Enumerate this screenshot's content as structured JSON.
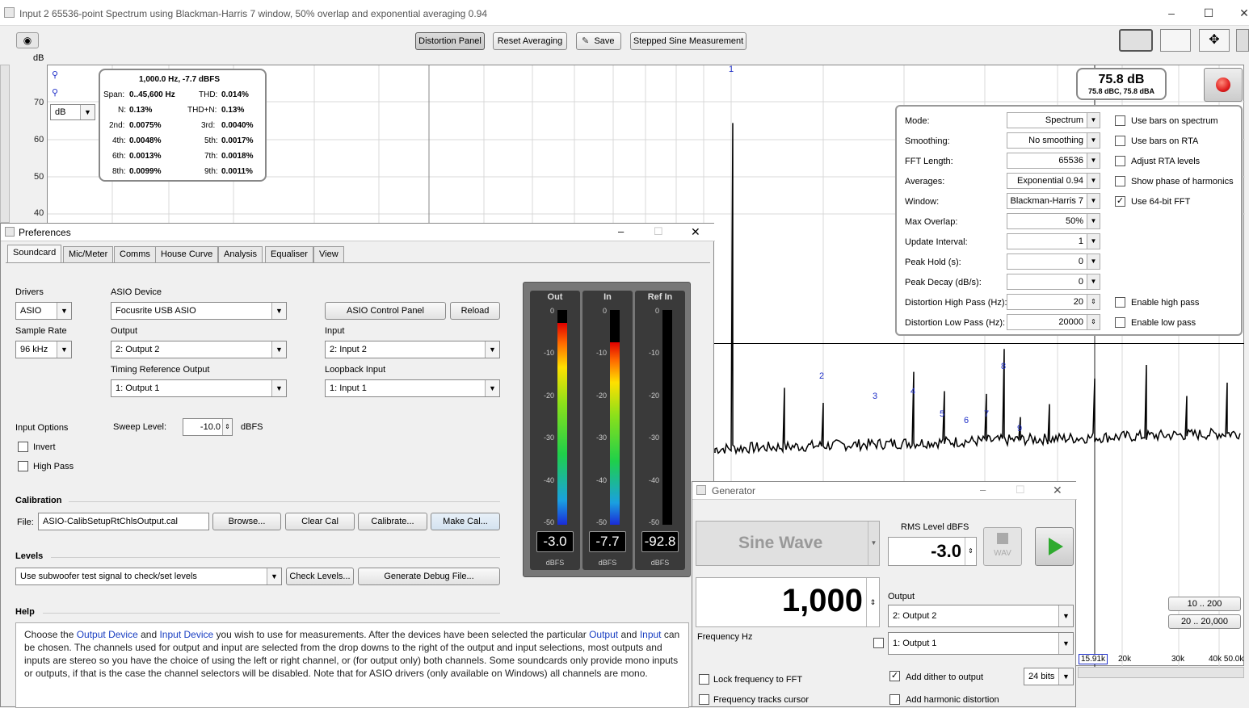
{
  "window": {
    "title": "Input 2 65536-point Spectrum using Blackman-Harris 7 window, 50% overlap and exponential averaging 0.94"
  },
  "toolbar": {
    "distortion_panel": "Distortion Panel",
    "reset_averaging": "Reset Averaging",
    "save": "Save",
    "stepped_sine": "Stepped Sine Measurement"
  },
  "plot": {
    "y_unit": "dB",
    "y_ticks": [
      "70",
      "60",
      "50",
      "40"
    ],
    "units_select": "dB",
    "harmonic_labels": [
      "1",
      "2",
      "3",
      "4",
      "5",
      "6",
      "7",
      "8",
      "9"
    ],
    "x_ticks": [
      "15.91k",
      "20k",
      "30k",
      "40k 50.0k"
    ],
    "range_buttons": [
      "10 .. 200",
      "20 .. 20,000"
    ]
  },
  "stats": {
    "header": "1,000.0 Hz, -7.7 dBFS",
    "span_label": "Span:",
    "span": "0..45,600 Hz",
    "thd_label": "THD:",
    "thd": "0.014%",
    "n_label": "N:",
    "n": "0.13%",
    "thdn_label": "THD+N:",
    "thdn": "0.13%",
    "h2_label": "2nd:",
    "h2": "0.0075%",
    "h3_label": "3rd:",
    "h3": "0.0040%",
    "h4_label": "4th:",
    "h4": "0.0048%",
    "h5_label": "5th:",
    "h5": "0.0017%",
    "h6_label": "6th:",
    "h6": "0.0013%",
    "h7_label": "7th:",
    "h7": "0.0018%",
    "h8_label": "8th:",
    "h8": "0.0099%",
    "h9_label": "9th:",
    "h9": "0.0011%"
  },
  "level_readout": {
    "main": "75.8 dB",
    "sub": "75.8 dBC, 75.8 dBA"
  },
  "config": {
    "mode_label": "Mode:",
    "mode": "Spectrum",
    "smoothing_label": "Smoothing:",
    "smoothing": "No  smoothing",
    "fft_label": "FFT Length:",
    "fft": "65536",
    "averages_label": "Averages:",
    "averages": "Exponential 0.94",
    "window_label": "Window:",
    "window": "Blackman-Harris 7",
    "overlap_label": "Max Overlap:",
    "overlap": "50%",
    "update_label": "Update Interval:",
    "update": "1",
    "peakhold_label": "Peak Hold (s):",
    "peakhold": "0",
    "peakdecay_label": "Peak Decay (dB/s):",
    "peakdecay": "0",
    "dhp_label": "Distortion High Pass (Hz):",
    "dhp": "20",
    "dlp_label": "Distortion Low Pass (Hz):",
    "dlp": "20000",
    "bars_spectrum": "Use bars on spectrum",
    "bars_rta": "Use bars on RTA",
    "adjust_rta": "Adjust RTA levels",
    "phase_harm": "Show phase of harmonics",
    "fft64": "Use 64-bit FFT",
    "enable_hp": "Enable high pass",
    "enable_lp": "Enable low pass",
    "checks": {
      "bars_spectrum": false,
      "bars_rta": false,
      "adjust_rta": false,
      "phase_harm": false,
      "fft64": true,
      "enable_hp": false,
      "enable_lp": false
    }
  },
  "prefs": {
    "title": "Preferences",
    "tabs": [
      "Soundcard",
      "Mic/Meter",
      "Comms",
      "House Curve",
      "Analysis",
      "Equaliser",
      "View"
    ],
    "drivers_label": "Drivers",
    "drivers": "ASIO",
    "asio_device_label": "ASIO Device",
    "asio_device": "Focusrite USB ASIO",
    "asio_control": "ASIO Control Panel",
    "reload": "Reload",
    "sample_rate_label": "Sample Rate",
    "sample_rate": "96 kHz",
    "output_label": "Output",
    "output": "2: Output 2",
    "input_label": "Input",
    "input": "2: Input 2",
    "timing_label": "Timing Reference Output",
    "timing": "1: Output 1",
    "loopback_label": "Loopback Input",
    "loopback": "1: Input 1",
    "input_options_label": "Input Options",
    "sweep_label": "Sweep Level:",
    "sweep": "-10.0",
    "sweep_unit": "dBFS",
    "invert": "Invert",
    "highpass": "High Pass",
    "calibration_label": "Calibration",
    "file_label": "File:",
    "cal_file": "ASIO-CalibSetupRtChlsOutput.cal",
    "browse": "Browse...",
    "clear_cal": "Clear Cal",
    "calibrate": "Calibrate...",
    "make_cal": "Make Cal...",
    "levels_label": "Levels",
    "levels_select": "Use subwoofer test signal to check/set levels",
    "check_levels": "Check Levels...",
    "debug": "Generate Debug File...",
    "help_label": "Help",
    "help_parts": [
      "Choose the ",
      "Output Device",
      " and ",
      "Input Device",
      " you wish to use for measurements. After the devices have been selected the particular ",
      "Output",
      " and ",
      "Input",
      " can be chosen. The channels used for output and input are selected from the drop downs to the right of the output and input selections, most outputs and inputs are stereo so you have the choice of using the left or right channel, or (for output only) both channels. Some soundcards only provide mono inputs or outputs, if that is the case the channel selectors will be disabled. Note that for ASIO drivers (only available on Windows) all channels are mono."
    ]
  },
  "meters": [
    {
      "name": "Out",
      "value": "-3.0",
      "unit": "dBFS",
      "level": 0.94
    },
    {
      "name": "In",
      "value": "-7.7",
      "unit": "dBFS",
      "level": 0.85
    },
    {
      "name": "Ref In",
      "value": "-92.8",
      "unit": "dBFS",
      "level": 0
    }
  ],
  "meter_ticks": [
    "0",
    "-10",
    "-20",
    "-30",
    "-40",
    "-50"
  ],
  "generator": {
    "title": "Generator",
    "waveform": "Sine Wave",
    "rms_label": "RMS Level dBFS",
    "rms": "-3.0",
    "wav": "WAV",
    "frequency": "1,000",
    "freq_label": "Frequency Hz",
    "output_label": "Output",
    "output": "2: Output 2",
    "output2": "1: Output 1",
    "lock": "Lock frequency to FFT",
    "tracks": "Frequency tracks cursor",
    "dither": "Add dither to output",
    "dither_bits": "24 bits",
    "harm": "Add harmonic distortion"
  },
  "colors": {
    "accent": "#1f2fc8",
    "play": "#2eaa2e",
    "record": "#e02020"
  }
}
